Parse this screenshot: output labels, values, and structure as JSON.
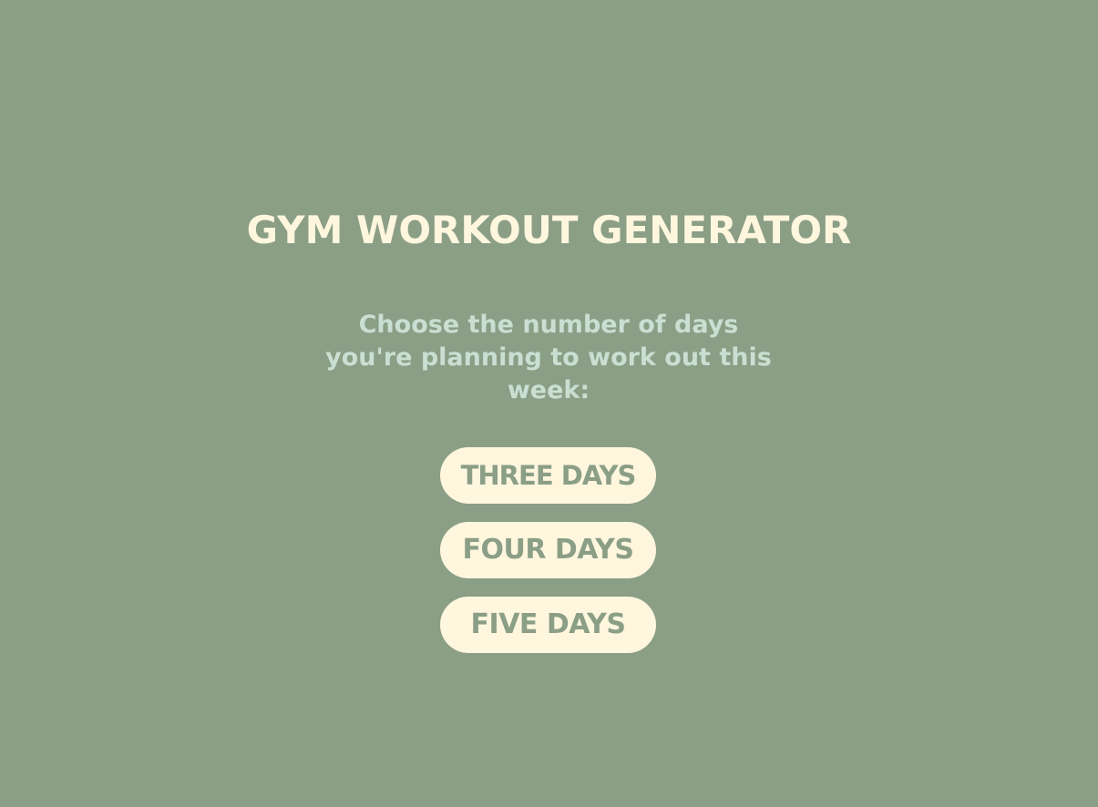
{
  "page": {
    "title": "GYM WORKOUT GENERATOR",
    "prompt": "Choose the number of days you're planning to work out this week:"
  },
  "options": [
    {
      "label": "THREE DAYS"
    },
    {
      "label": "FOUR DAYS"
    },
    {
      "label": "FIVE DAYS"
    }
  ],
  "colors": {
    "background": "#8b9e86",
    "title": "#fff6de",
    "prompt": "#c9dfd2",
    "button_bg": "#fff6de",
    "button_text": "#8b9e86"
  }
}
